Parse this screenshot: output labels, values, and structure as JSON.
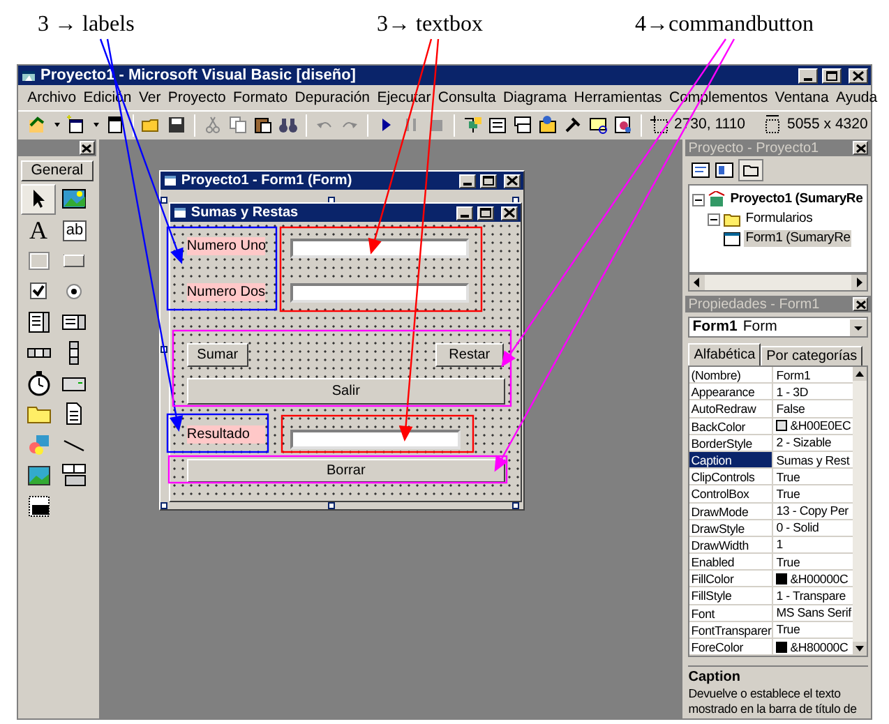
{
  "annotations": [
    {
      "text": "3 → labels",
      "color": "#0000ff"
    },
    {
      "text": "3→ textbox",
      "color": "#ff0000"
    },
    {
      "text": "4→commandbutton",
      "color": "#ff00ff"
    }
  ],
  "window": {
    "title": "Proyecto1 - Microsoft Visual Basic [diseño]"
  },
  "menu": [
    "Archivo",
    "Edición",
    "Ver",
    "Proyecto",
    "Formato",
    "Depuración",
    "Ejecutar",
    "Consulta",
    "Diagrama",
    "Herramientas",
    "Complementos",
    "Ventana",
    "Ayuda"
  ],
  "toolbar": {
    "position": "2730, 1110",
    "size": "5055 x 4320"
  },
  "toolbox": {
    "tab": "General",
    "items": [
      {
        "kind": "pointer",
        "selected": true
      },
      {
        "kind": "picture",
        "selected": false
      },
      {
        "kind": "letter",
        "text": "A",
        "selected": false
      },
      {
        "kind": "textbox",
        "text": "ab",
        "selected": false
      },
      {
        "kind": "frame",
        "selected": false
      },
      {
        "kind": "button",
        "selected": false
      },
      {
        "kind": "checkbox",
        "selected": false
      },
      {
        "kind": "radio",
        "selected": false
      },
      {
        "kind": "combo",
        "selected": false
      },
      {
        "kind": "list",
        "selected": false
      },
      {
        "kind": "hscroll",
        "selected": false
      },
      {
        "kind": "vscroll",
        "selected": false
      },
      {
        "kind": "timer",
        "selected": false
      },
      {
        "kind": "drive",
        "selected": false
      },
      {
        "kind": "folder",
        "selected": false
      },
      {
        "kind": "file",
        "selected": false
      },
      {
        "kind": "shape",
        "selected": false
      },
      {
        "kind": "line",
        "selected": false
      },
      {
        "kind": "image",
        "selected": false
      },
      {
        "kind": "data",
        "selected": false
      },
      {
        "kind": "ole",
        "selected": false
      }
    ]
  },
  "designer": {
    "title": "Proyecto1 - Form1 (Form)",
    "form": {
      "title": "Sumas y Restas",
      "controls": [
        {
          "kind": "label",
          "text": "Numero Uno"
        },
        {
          "kind": "label",
          "text": "Numero Dos"
        },
        {
          "kind": "textbox"
        },
        {
          "kind": "textbox"
        },
        {
          "kind": "button",
          "text": "Sumar"
        },
        {
          "kind": "button",
          "text": "Restar"
        },
        {
          "kind": "button",
          "text": "Salir"
        },
        {
          "kind": "label",
          "text": "Resultado"
        },
        {
          "kind": "textbox"
        },
        {
          "kind": "button",
          "text": "Borrar"
        }
      ]
    }
  },
  "project": {
    "title": "Proyecto - Proyecto1",
    "tree": [
      {
        "label": "Proyecto1 (SumaryRe",
        "expanded": true,
        "children": [
          {
            "label": "Formularios",
            "expanded": true,
            "children": [
              {
                "label": "Form1 (SumaryRe",
                "selected": true
              }
            ]
          }
        ]
      }
    ]
  },
  "properties": {
    "title": "Propiedades - Form1",
    "object": "Form1",
    "object_type": "Form",
    "tabs": [
      {
        "label": "Alfabética",
        "selected": true
      },
      {
        "label": "Por categorías",
        "selected": false
      }
    ],
    "rows": [
      {
        "name": "(Nombre)",
        "value": "Form1",
        "selected": false
      },
      {
        "name": "Appearance",
        "value": "1 - 3D",
        "selected": false
      },
      {
        "name": "AutoRedraw",
        "value": "False",
        "selected": false
      },
      {
        "name": "BackColor",
        "value": "&H00E0EC",
        "color": "#e0e0e0",
        "selected": false
      },
      {
        "name": "BorderStyle",
        "value": "2 - Sizable",
        "selected": false
      },
      {
        "name": "Caption",
        "value": "Sumas y Rest",
        "selected": true
      },
      {
        "name": "ClipControls",
        "value": "True",
        "selected": false
      },
      {
        "name": "ControlBox",
        "value": "True",
        "selected": false
      },
      {
        "name": "DrawMode",
        "value": "13 - Copy Per",
        "selected": false
      },
      {
        "name": "DrawStyle",
        "value": "0 - Solid",
        "selected": false
      },
      {
        "name": "DrawWidth",
        "value": "1",
        "selected": false
      },
      {
        "name": "Enabled",
        "value": "True",
        "selected": false
      },
      {
        "name": "FillColor",
        "value": "&H00000C",
        "color": "#000000",
        "selected": false
      },
      {
        "name": "FillStyle",
        "value": "1 - Transpare",
        "selected": false
      },
      {
        "name": "Font",
        "value": "MS Sans Serif",
        "selected": false
      },
      {
        "name": "FontTransparer",
        "value": "True",
        "selected": false
      },
      {
        "name": "ForeColor",
        "value": "&H80000C",
        "color": "#000000",
        "selected": false
      }
    ],
    "description": {
      "title": "Caption",
      "text": "Devuelve o establece el texto mostrado en la barra de título de"
    }
  }
}
